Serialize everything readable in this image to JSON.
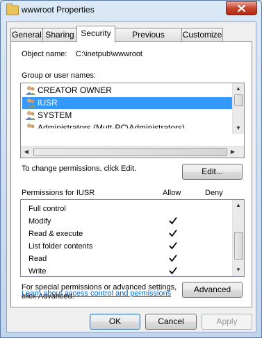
{
  "window": {
    "title": "wwwroot Properties",
    "icon": "folder-icon",
    "close_icon": "close-icon"
  },
  "tabs": [
    {
      "label": "General",
      "active": false
    },
    {
      "label": "Sharing",
      "active": false
    },
    {
      "label": "Security",
      "active": true
    },
    {
      "label": "Previous Versions",
      "active": false
    },
    {
      "label": "Customize",
      "active": false
    }
  ],
  "security": {
    "object_name_label": "Object name:",
    "object_name_value": "C:\\inetpub\\wwwroot",
    "group_label": "Group or user names:",
    "users": [
      {
        "name": "CREATOR OWNER",
        "selected": false
      },
      {
        "name": "IUSR",
        "selected": true
      },
      {
        "name": "SYSTEM",
        "selected": false
      },
      {
        "name": "Administrators (Mutt-PC\\Administrators)",
        "selected": false
      }
    ],
    "change_text": "To change permissions, click Edit.",
    "edit_button": "Edit...",
    "permissions_for": "Permissions for IUSR",
    "allow_header": "Allow",
    "deny_header": "Deny",
    "permissions": [
      {
        "name": "Full control",
        "allow": false,
        "deny": false
      },
      {
        "name": "Modify",
        "allow": true,
        "deny": false
      },
      {
        "name": "Read & execute",
        "allow": true,
        "deny": false
      },
      {
        "name": "List folder contents",
        "allow": true,
        "deny": false
      },
      {
        "name": "Read",
        "allow": true,
        "deny": false
      },
      {
        "name": "Write",
        "allow": true,
        "deny": false
      }
    ],
    "special_line1": "For special permissions or advanced settings,",
    "special_line2": "click Advanced.",
    "advanced_button": "Advanced",
    "learn_link": "Learn about access control and permissions"
  },
  "buttons": {
    "ok": "OK",
    "cancel": "Cancel",
    "apply": "Apply"
  },
  "colors": {
    "selection": "#3399ff",
    "link": "#0066cc"
  }
}
